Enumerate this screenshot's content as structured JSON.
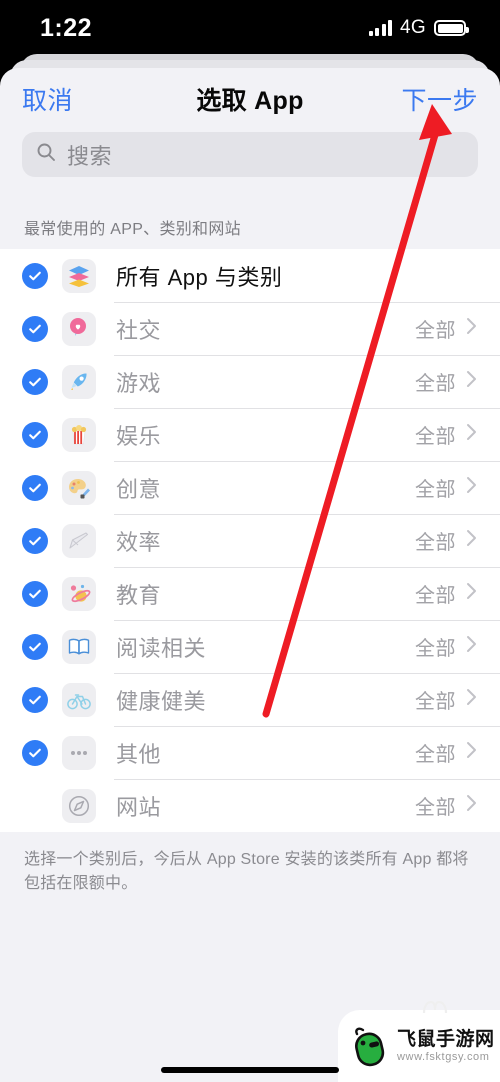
{
  "status_bar": {
    "time": "1:22",
    "network": "4G",
    "signal_icon": "signal-bars-icon",
    "battery_icon": "battery-icon"
  },
  "nav": {
    "cancel_label": "取消",
    "title": "选取 App",
    "next_label": "下一步",
    "accent_color": "#3b79f0"
  },
  "search": {
    "placeholder": "搜索",
    "icon": "search-icon"
  },
  "section_header": "最常使用的 APP、类别和网站",
  "list": {
    "value_label": "全部",
    "rows": [
      {
        "label": "所有 App 与类别",
        "icon": "layers-stack-icon",
        "checked": true,
        "value": "",
        "chevron": false,
        "primary": true
      },
      {
        "label": "社交",
        "icon": "chat-heart-icon",
        "checked": true,
        "value": "全部",
        "chevron": true,
        "primary": false
      },
      {
        "label": "游戏",
        "icon": "rocket-icon",
        "checked": true,
        "value": "全部",
        "chevron": true,
        "primary": false
      },
      {
        "label": "娱乐",
        "icon": "popcorn-icon",
        "checked": true,
        "value": "全部",
        "chevron": true,
        "primary": false
      },
      {
        "label": "创意",
        "icon": "palette-icon",
        "checked": true,
        "value": "全部",
        "chevron": true,
        "primary": false
      },
      {
        "label": "效率",
        "icon": "pen-check-icon",
        "checked": true,
        "value": "全部",
        "chevron": true,
        "primary": false
      },
      {
        "label": "教育",
        "icon": "planet-icon",
        "checked": true,
        "value": "全部",
        "chevron": true,
        "primary": false
      },
      {
        "label": "阅读相关",
        "icon": "open-book-icon",
        "checked": true,
        "value": "全部",
        "chevron": true,
        "primary": false
      },
      {
        "label": "健康健美",
        "icon": "bicycle-icon",
        "checked": true,
        "value": "全部",
        "chevron": true,
        "primary": false
      },
      {
        "label": "其他",
        "icon": "ellipsis-icon",
        "checked": true,
        "value": "全部",
        "chevron": true,
        "primary": false
      },
      {
        "label": "网站",
        "icon": "compass-icon",
        "checked": false,
        "value": "全部",
        "chevron": true,
        "primary": false
      }
    ]
  },
  "footnote": "选择一个类别后，今后从 App Store 安装的该类所有 App 都将包括在限额中。",
  "annotation": {
    "type": "arrow",
    "color": "#ee1c24",
    "points_to": "下一步"
  },
  "watermark": {
    "name": "飞鼠手游网",
    "url": "www.fsktgsy.com",
    "logo_icon": "green-mouse-icon",
    "logo_color": "#27ae3f"
  }
}
